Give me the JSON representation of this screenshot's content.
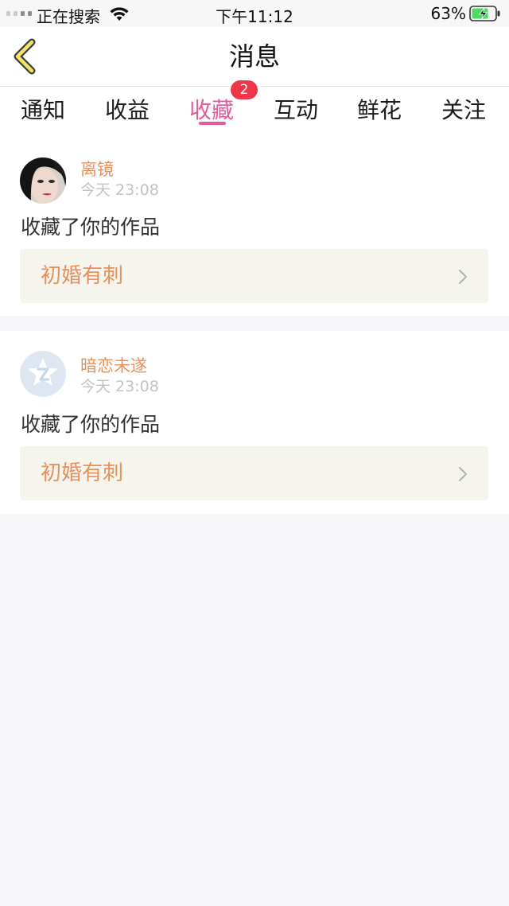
{
  "status_bar": {
    "carrier": "正在搜索",
    "time": "下午11:12",
    "battery": "63%"
  },
  "nav": {
    "title": "消息"
  },
  "tabs": [
    {
      "label": "通知"
    },
    {
      "label": "收益"
    },
    {
      "label": "收藏",
      "active": true,
      "badge": "2"
    },
    {
      "label": "互动"
    },
    {
      "label": "鲜花"
    },
    {
      "label": "关注"
    }
  ],
  "colors": {
    "accent": "#e35a9d",
    "badge": "#f0364a",
    "username": "#e8905a",
    "work_bg": "#f5f4ed"
  },
  "notifications": [
    {
      "user": "离镜",
      "time": "今天 23:08",
      "action": "收藏了你的作品",
      "work_title": "初婚有刺"
    },
    {
      "user": "暗恋未遂",
      "time": "今天 23:08",
      "action": "收藏了你的作品",
      "work_title": "初婚有刺"
    }
  ]
}
